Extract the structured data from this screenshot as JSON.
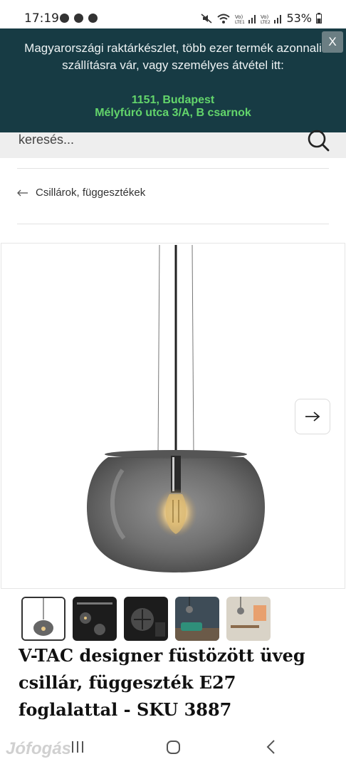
{
  "status_bar": {
    "time": "17:19",
    "battery": "53%",
    "icons": [
      "facebook-icon",
      "viber-icon",
      "facebook-icon",
      "mute-icon",
      "wifi-icon",
      "volte-signal-icon",
      "volte-signal-icon",
      "battery-icon"
    ]
  },
  "banner": {
    "text": "Magyarországi raktárkészlet, több ezer termék azonnali szállításra vár, vagy személyes átvétel itt:",
    "city": "1151, Budapest",
    "address": "Mélyfúró utca 3/A, B csarnok",
    "close_label": "X",
    "background_color": "#173b44",
    "highlight_color": "#63d56b"
  },
  "search": {
    "placeholder": "keresés..."
  },
  "breadcrumb": {
    "label": "Csillárok, függesztékek"
  },
  "product": {
    "title": "V-TAC designer füstözött üveg csillár, függeszték E27 foglalattal - SKU 3887",
    "thumbnails": [
      "smoky-glass-pendant",
      "product-box-dark",
      "product-box-dark",
      "living-room-scene",
      "dining-room-scene"
    ]
  },
  "nav_bar": {
    "icons": [
      "recent-apps-icon",
      "home-icon",
      "back-icon"
    ]
  },
  "watermark": "Jófogás"
}
